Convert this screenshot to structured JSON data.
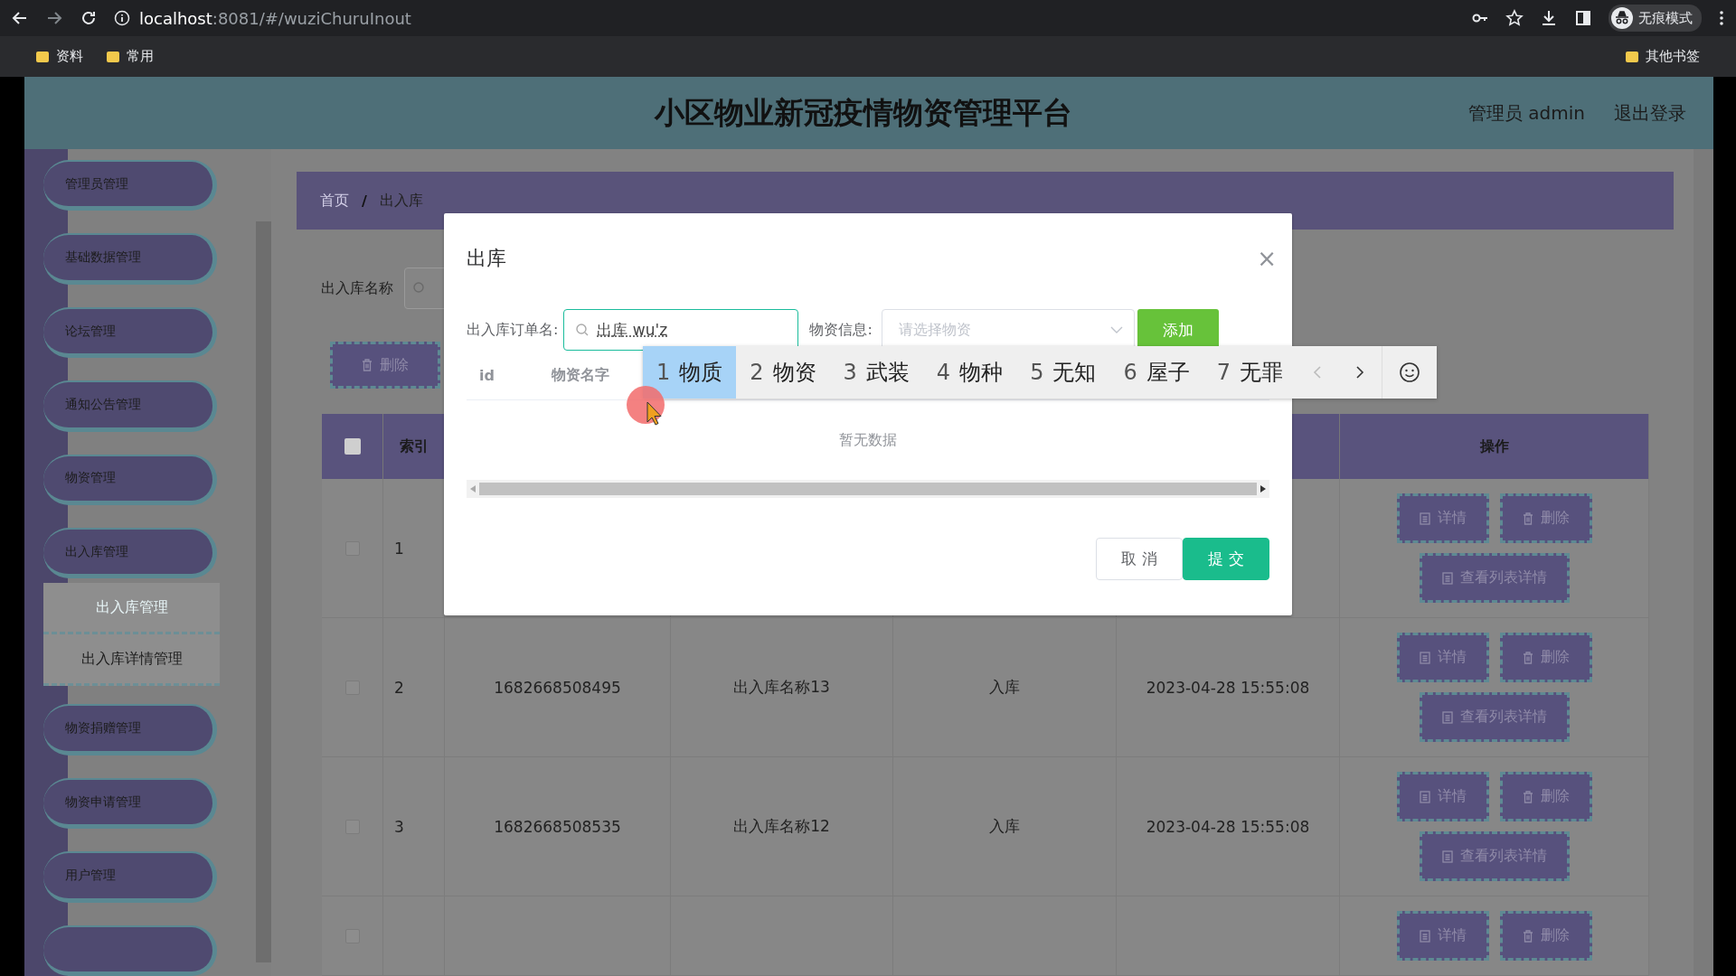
{
  "browser": {
    "url_host": "localhost",
    "url_rest": ":8081/#/wuziChuruInout",
    "profile": "无痕模式",
    "bookmarks": [
      "资料",
      "常用"
    ],
    "other_bookmarks": "其他书签"
  },
  "header": {
    "title": "小区物业新冠疫情物资管理平台",
    "user": "管理员 admin",
    "logout": "退出登录"
  },
  "sidebar": {
    "items": [
      {
        "label": "管理员管理",
        "expanded": false
      },
      {
        "label": "基础数据管理",
        "expanded": false
      },
      {
        "label": "论坛管理",
        "expanded": false
      },
      {
        "label": "通知公告管理",
        "expanded": false
      },
      {
        "label": "物资管理",
        "expanded": false
      },
      {
        "label": "出入库管理",
        "expanded": true,
        "children": [
          {
            "label": "出入库管理",
            "selected": true
          },
          {
            "label": "出入库详情管理",
            "selected": false
          }
        ]
      },
      {
        "label": "物资捐赠管理",
        "expanded": false
      },
      {
        "label": "物资申请管理",
        "expanded": false
      },
      {
        "label": "用户管理",
        "expanded": false
      }
    ]
  },
  "breadcrumb": {
    "items": [
      "首页",
      "出入库"
    ],
    "separator": "/"
  },
  "search": {
    "label": "出入库名称"
  },
  "delete_button": "删除",
  "table": {
    "select_all": {
      "checked": false
    },
    "header_index": "索引",
    "header_actions": "操作",
    "rows": [
      {
        "checked": false,
        "index": "1",
        "actions": [
          "详情",
          "删除",
          "查看列表详情"
        ]
      },
      {
        "checked": false,
        "index": "2",
        "column_3": "1682668508495",
        "column_4": "出入库名称13",
        "column_5": "入库",
        "column_6": "2023-04-28 15:55:08",
        "actions": [
          "详情",
          "删除",
          "查看列表详情"
        ]
      },
      {
        "checked": false,
        "index": "3",
        "column_3": "1682668508535",
        "column_4": "出入库名称12",
        "column_5": "入库",
        "column_6": "2023-04-28 15:55:08",
        "actions": [
          "详情",
          "删除",
          "查看列表详情"
        ]
      },
      {
        "checked": false,
        "actions": [
          "详情",
          "删除"
        ]
      }
    ]
  },
  "dialog": {
    "title": "出库",
    "close": "×",
    "order_label": "出入库订单名:",
    "order_value": "出库 wu'z",
    "material_label": "物资信息:",
    "material_placeholder": "请选择物资",
    "add_button": "添加",
    "columns": [
      "id",
      "物资名字"
    ],
    "empty_text": "暂无数据",
    "cancel_button": "取消",
    "submit_button": "提交"
  },
  "ime": {
    "candidates": [
      {
        "number": "1",
        "word": "物质",
        "selected": true
      },
      {
        "number": "2",
        "word": "物资",
        "selected": false
      },
      {
        "number": "3",
        "word": "武装",
        "selected": false
      },
      {
        "number": "4",
        "word": "物种",
        "selected": false
      },
      {
        "number": "5",
        "word": "无知",
        "selected": false
      },
      {
        "number": "6",
        "word": "屋子",
        "selected": false
      },
      {
        "number": "7",
        "word": "无罪",
        "selected": false
      }
    ]
  }
}
